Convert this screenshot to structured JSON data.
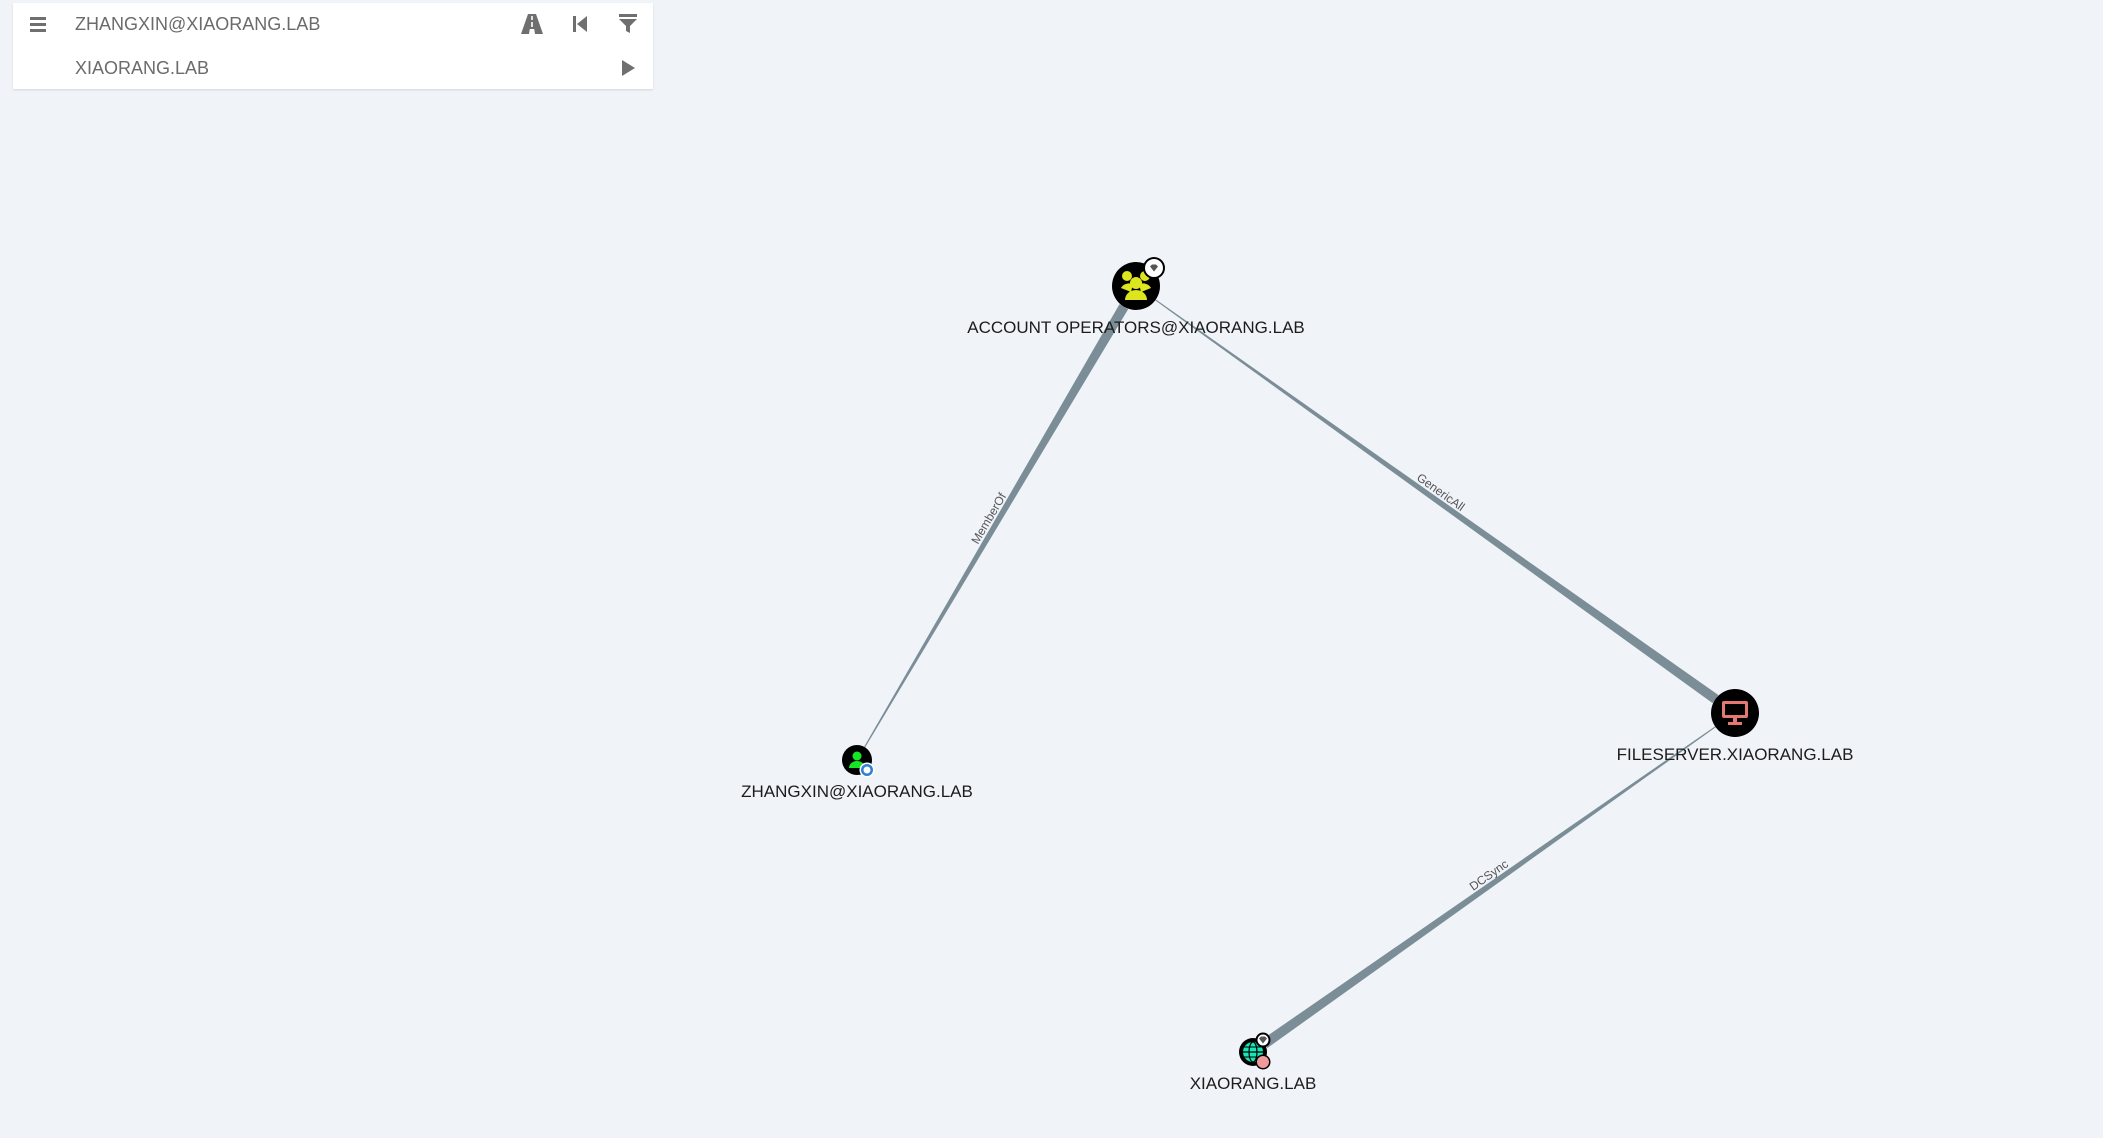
{
  "search": {
    "start_node_value": "ZHANGXIN@XIAORANG.LAB",
    "target_node_value": "XIAORANG.LAB"
  },
  "toolbar": {
    "menu_icon": "hamburger-menu-icon",
    "pathfinding_icon": "road-icon",
    "back_icon": "step-backward-icon",
    "filter_icon": "filter-icon",
    "play_icon": "play-icon"
  },
  "graph": {
    "nodes": [
      {
        "id": "account_operators",
        "label": "ACCOUNT OPERATORS@XIAORANG.LAB",
        "type": "group",
        "icon": "group-icon",
        "badge": "high-value-gem-icon",
        "color": "#dde51f"
      },
      {
        "id": "zhangxin",
        "label": "ZHANGXIN@XIAORANG.LAB",
        "type": "user",
        "icon": "user-icon",
        "badge": "owned-target-icon",
        "color": "#17e625"
      },
      {
        "id": "fileserver",
        "label": "FILESERVER.XIAORANG.LAB",
        "type": "computer",
        "icon": "computer-icon",
        "badge": "",
        "color": "#e67873"
      },
      {
        "id": "domain",
        "label": "XIAORANG.LAB",
        "type": "domain",
        "icon": "globe-icon",
        "badge": "high-value-gem-icon",
        "color": "#17e6b9"
      }
    ],
    "edges": [
      {
        "label": "MemberOf",
        "from": "zhangxin",
        "to": "account_operators"
      },
      {
        "label": "GenericAll",
        "from": "account_operators",
        "to": "fileserver"
      },
      {
        "label": "DCSync",
        "from": "fileserver",
        "to": "domain"
      }
    ],
    "edge_color": "#7b8d97"
  }
}
